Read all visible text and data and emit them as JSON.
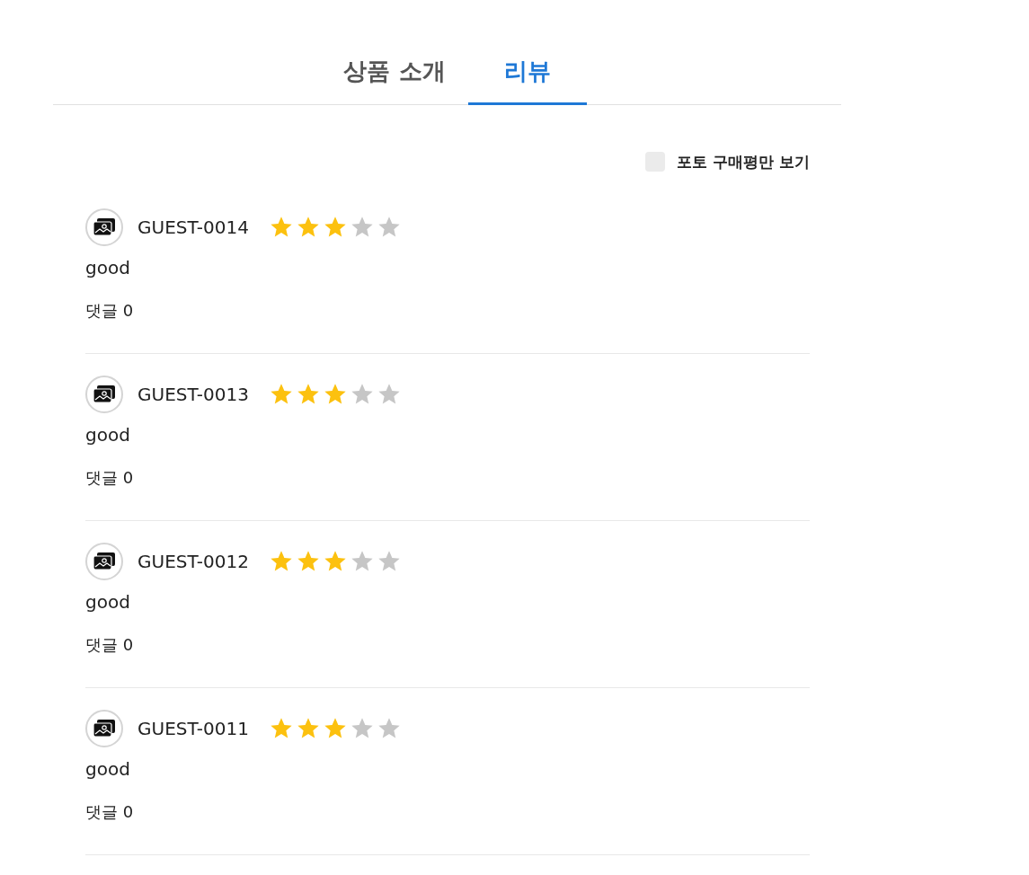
{
  "tabs": [
    {
      "label": "상품 소개",
      "selected": false
    },
    {
      "label": "리뷰",
      "selected": true
    }
  ],
  "photo_filter": {
    "label": "포토 구매평만 보기",
    "checked": false
  },
  "reviews": [
    {
      "author": "GUEST-0014",
      "stars": 3,
      "text": "good",
      "comments": "댓글 0"
    },
    {
      "author": "GUEST-0013",
      "stars": 3,
      "text": "good",
      "comments": "댓글 0"
    },
    {
      "author": "GUEST-0012",
      "stars": 3,
      "text": "good",
      "comments": "댓글 0"
    },
    {
      "author": "GUEST-0011",
      "stars": 3,
      "text": "good",
      "comments": "댓글 0"
    }
  ]
}
